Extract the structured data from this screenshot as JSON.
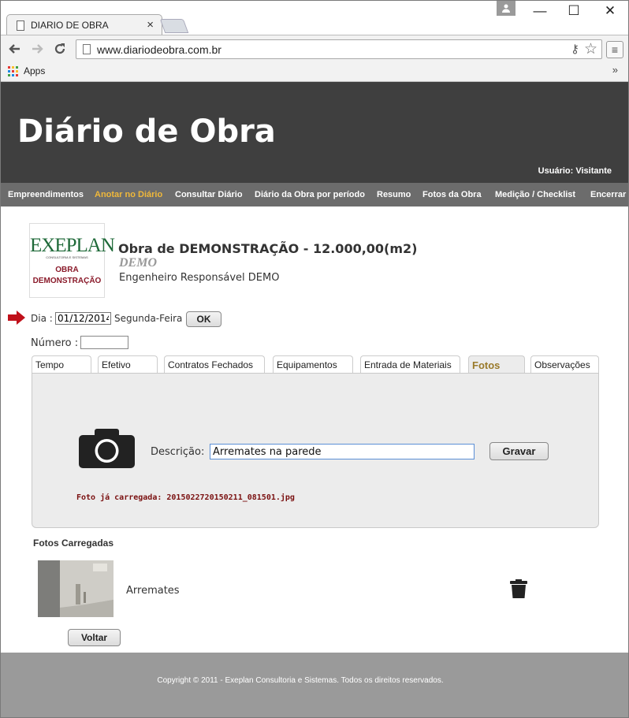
{
  "browser": {
    "tab_title": "DIARIO DE OBRA",
    "tab_close": "×",
    "window_buttons": {
      "minimize": "—",
      "maximize": "☐",
      "close": "✕"
    },
    "url": "www.diariodeobra.com.br",
    "bookmarks": {
      "apps_label": "Apps",
      "chevron": "»"
    }
  },
  "header": {
    "title": "Diário de Obra",
    "user_label": "Usuário: Visitante"
  },
  "nav": {
    "items": [
      {
        "label": "Empreendimentos"
      },
      {
        "label": "Anotar no Diário",
        "active": true
      },
      {
        "label": "Consultar Diário"
      },
      {
        "label": "Diário da Obra por período"
      },
      {
        "label": "Resumo"
      },
      {
        "label": "Fotos da Obra"
      },
      {
        "label": "Medição / Checklist"
      },
      {
        "label": "Encerrar"
      }
    ],
    "active_color": "#f0b83a"
  },
  "logo": {
    "brand": "EXEPLAN",
    "subtitle": "CONSULTORIA E SISTEMAS",
    "line1": "OBRA",
    "line2": "DEMONSTRAÇÃO"
  },
  "obra": {
    "title": "Obra de DEMONSTRAÇÃO - 12.000,00(m2)",
    "code": "DEMO",
    "engineer": "Engenheiro Responsável DEMO"
  },
  "form": {
    "dia_label": "Dia :",
    "dia_value": "01/12/2014",
    "weekday": "Segunda-Feira",
    "ok_label": "OK",
    "numero_label": "Número :",
    "numero_value": ""
  },
  "tabs": [
    {
      "label": "Tempo"
    },
    {
      "label": "Efetivo"
    },
    {
      "label": "Contratos Fechados"
    },
    {
      "label": "Equipamentos"
    },
    {
      "label": "Entrada de Materiais"
    },
    {
      "label": "Fotos",
      "active": true
    },
    {
      "label": "Observações"
    }
  ],
  "fotos": {
    "descricao_label": "Descrição:",
    "descricao_value": "Arremates na parede",
    "gravar_label": "Gravar",
    "photo_note": "Foto já carregada: 2015022720150211_081501.jpg",
    "heading": "Fotos Carregadas",
    "items": [
      {
        "caption": "Arremates"
      }
    ],
    "voltar_label": "Voltar"
  },
  "footer": {
    "copyright": "Copyright © 2011 - Exeplan Consultoria e Sistemas. Todos os direitos reservados."
  },
  "colors": {
    "header_bg": "#3f3f3f",
    "nav_bg": "#6c6c6c",
    "annotation_arrow": "#c0101a",
    "active_tab": "#9a7a2a",
    "footer_bg": "#9a9a9a"
  }
}
